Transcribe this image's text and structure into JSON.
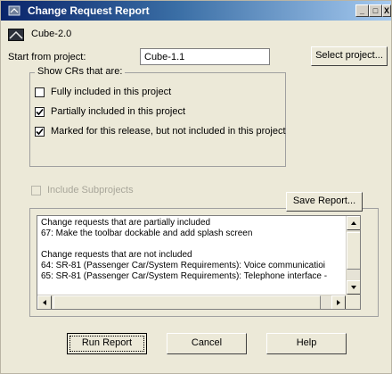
{
  "window": {
    "title": "Change Request Report",
    "controls": [
      "_",
      "□",
      "X"
    ]
  },
  "project": {
    "name": "Cube-2.0"
  },
  "start": {
    "label": "Start from project:",
    "value": "Cube-1.1",
    "select_button": "Select project..."
  },
  "show_crs": {
    "legend": "Show CRs that are:",
    "options": [
      {
        "label": "Fully included in this project",
        "checked": false
      },
      {
        "label": "Partially included in this project",
        "checked": true
      },
      {
        "label": "Marked for this release, but not included in this project",
        "checked": true
      }
    ]
  },
  "include_subprojects": {
    "label": "Include Subprojects",
    "checked": false,
    "enabled": false
  },
  "report": {
    "save_button": "Save Report...",
    "lines": [
      "Change requests that are partially included",
      "67: Make the toolbar dockable and add splash screen",
      "",
      "Change requests that are not included",
      "64: SR-81 (Passenger Car/System Requirements): Voice communicatioi",
      "65: SR-81 (Passenger Car/System Requirements): Telephone interface -"
    ]
  },
  "buttons": {
    "run": "Run Report",
    "cancel": "Cancel",
    "help": "Help"
  },
  "colors": {
    "title_bar_start": "#0a246a",
    "title_bar_end": "#a6caf0",
    "dialog_bg": "#ece9d8"
  }
}
